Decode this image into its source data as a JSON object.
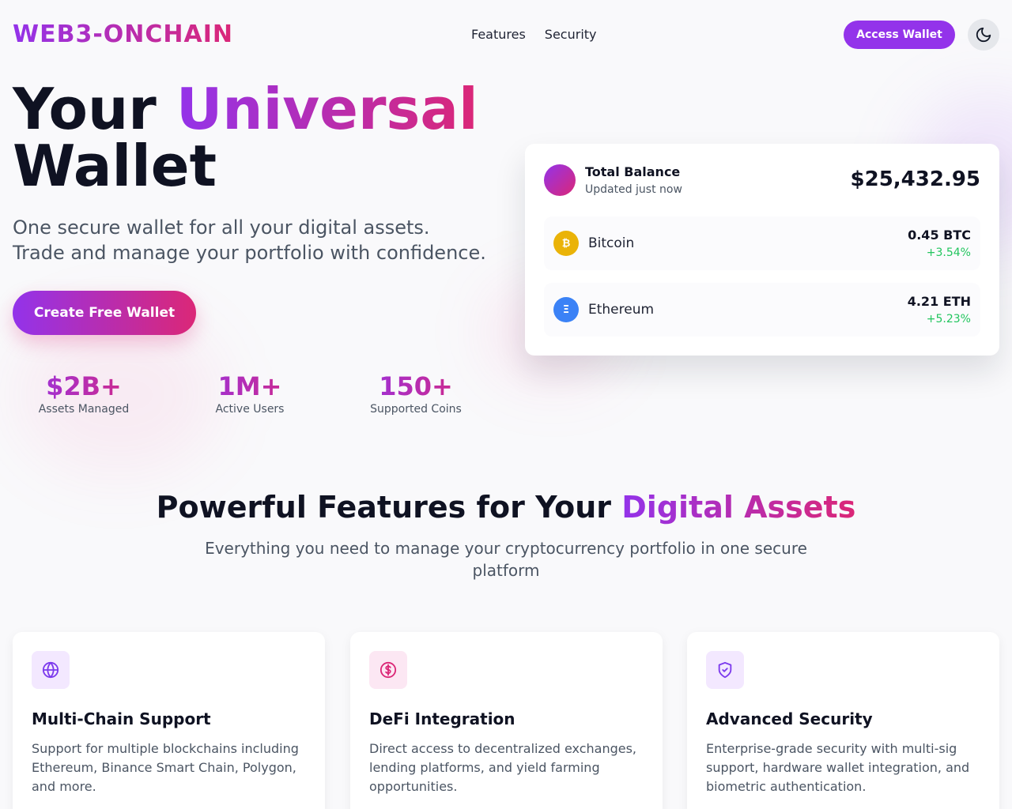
{
  "header": {
    "logo": "WEB3-ONCHAIN",
    "nav": [
      "Features",
      "Security"
    ],
    "access_button": "Access Wallet",
    "theme_toggle_icon": "moon-icon"
  },
  "hero": {
    "title_part1": "Your",
    "title_part2": "Universal",
    "title_part3": "Wallet",
    "subtitle_line1": "One secure wallet for all your digital assets.",
    "subtitle_line2": "Trade and manage your portfolio with confidence.",
    "cta": "Create Free Wallet",
    "stats": [
      {
        "value": "$2B+",
        "label": "Assets Managed"
      },
      {
        "value": "1M+",
        "label": "Active Users"
      },
      {
        "value": "150+",
        "label": "Supported Coins"
      }
    ]
  },
  "balance": {
    "title": "Total Balance",
    "updated": "Updated just now",
    "amount": "$25,432.95",
    "assets": [
      {
        "name": "Bitcoin",
        "symbol": "₿",
        "amount": "0.45 BTC",
        "change": "+3.54%",
        "color": "#eab308",
        "icon": "bitcoin-icon"
      },
      {
        "name": "Ethereum",
        "symbol": "Ξ",
        "amount": "4.21 ETH",
        "change": "+5.23%",
        "color": "#3b82f6",
        "icon": "ethereum-icon"
      }
    ]
  },
  "features": {
    "title_part1": "Powerful Features for Your",
    "title_part2": "Digital Assets",
    "subtitle": "Everything you need to manage your cryptocurrency portfolio in one secure platform",
    "cards": [
      {
        "icon": "globe-icon",
        "title": "Multi-Chain Support",
        "desc": "Support for multiple blockchains including Ethereum, Binance Smart Chain, Polygon, and more."
      },
      {
        "icon": "dollar-circle-icon",
        "title": "DeFi Integration",
        "desc": "Direct access to decentralized exchanges, lending platforms, and yield farming opportunities."
      },
      {
        "icon": "shield-check-icon",
        "title": "Advanced Security",
        "desc": "Enterprise-grade security with multi-sig support, hardware wallet integration, and biometric authentication."
      }
    ]
  },
  "colors": {
    "accent": "#9333ea",
    "accent2": "#db2777",
    "positive": "#22c55e"
  }
}
